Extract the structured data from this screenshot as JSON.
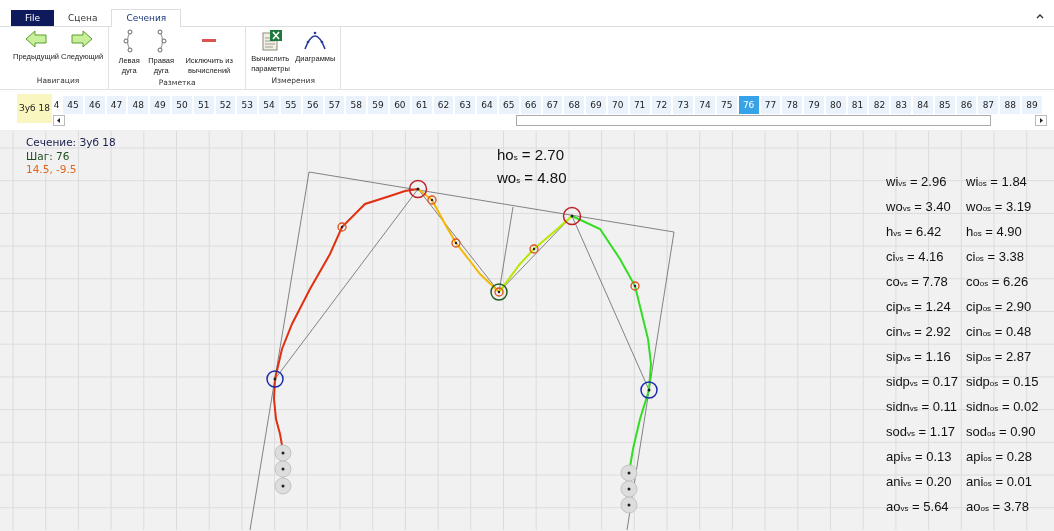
{
  "menu_tabs": [
    {
      "label": "File",
      "kind": "file",
      "selected": false
    },
    {
      "label": "Сцена",
      "kind": "tab",
      "selected": false
    },
    {
      "label": "Сечения",
      "kind": "tab",
      "selected": true
    }
  ],
  "ribbon_groups": [
    {
      "label": "Навигация",
      "buttons": [
        {
          "label": "Предыдущий",
          "kind": "prev"
        },
        {
          "label": "Следующий",
          "kind": "next"
        }
      ]
    },
    {
      "label": "Разметка",
      "buttons": [
        {
          "label": "Левая дуга",
          "kind": "left-arc"
        },
        {
          "label": "Правая дуга",
          "kind": "right-arc"
        },
        {
          "label": "Исключить из вычислений",
          "kind": "exclude"
        }
      ]
    },
    {
      "label": "Измерения",
      "buttons": [
        {
          "label": "Вычислить параметры",
          "kind": "calc"
        },
        {
          "label": "Диаграммы",
          "kind": "chart"
        }
      ]
    }
  ],
  "section_label": "Зуб 18",
  "steps": [
    {
      "label": "4",
      "selected": false
    },
    {
      "label": "45",
      "selected": false
    },
    {
      "label": "46",
      "selected": false
    },
    {
      "label": "47",
      "selected": false
    },
    {
      "label": "48",
      "selected": false
    },
    {
      "label": "49",
      "selected": false
    },
    {
      "label": "50",
      "selected": false
    },
    {
      "label": "51",
      "selected": false
    },
    {
      "label": "52",
      "selected": false
    },
    {
      "label": "53",
      "selected": false
    },
    {
      "label": "54",
      "selected": false
    },
    {
      "label": "55",
      "selected": false
    },
    {
      "label": "56",
      "selected": false
    },
    {
      "label": "57",
      "selected": false
    },
    {
      "label": "58",
      "selected": false
    },
    {
      "label": "59",
      "selected": false
    },
    {
      "label": "60",
      "selected": false
    },
    {
      "label": "61",
      "selected": false
    },
    {
      "label": "62",
      "selected": false
    },
    {
      "label": "63",
      "selected": false
    },
    {
      "label": "64",
      "selected": false
    },
    {
      "label": "65",
      "selected": false
    },
    {
      "label": "66",
      "selected": false
    },
    {
      "label": "67",
      "selected": false
    },
    {
      "label": "68",
      "selected": false
    },
    {
      "label": "69",
      "selected": false
    },
    {
      "label": "70",
      "selected": false
    },
    {
      "label": "71",
      "selected": false
    },
    {
      "label": "72",
      "selected": false
    },
    {
      "label": "73",
      "selected": false
    },
    {
      "label": "74",
      "selected": false
    },
    {
      "label": "75",
      "selected": false
    },
    {
      "label": "76",
      "selected": true
    },
    {
      "label": "77",
      "selected": false
    },
    {
      "label": "78",
      "selected": false
    },
    {
      "label": "79",
      "selected": false
    },
    {
      "label": "80",
      "selected": false
    },
    {
      "label": "81",
      "selected": false
    },
    {
      "label": "82",
      "selected": false
    },
    {
      "label": "83",
      "selected": false
    },
    {
      "label": "84",
      "selected": false
    },
    {
      "label": "85",
      "selected": false
    },
    {
      "label": "86",
      "selected": false
    },
    {
      "label": "87",
      "selected": false
    },
    {
      "label": "88",
      "selected": false
    },
    {
      "label": "89",
      "selected": false
    }
  ],
  "info": [
    {
      "text": "Сечение: Зуб 18",
      "kind": "section"
    },
    {
      "text": "Шаг: 76",
      "kind": "step"
    },
    {
      "text": "14.5, -9.5",
      "kind": "coords"
    }
  ],
  "top_values": [
    "ho$_{s}$ = 2.70",
    "wo$_{s}$ = 4.80"
  ],
  "measurements": [
    [
      "wi$_{vs}$ = 2.96",
      "wi$_{os}$ = 1.84"
    ],
    [
      "wo$_{vs}$ = 3.40",
      "wo$_{os}$ = 3.19"
    ],
    [
      "h$_{vs}$ = 6.42",
      "h$_{os}$ = 4.90"
    ],
    [
      "ci$_{vs}$ = 4.16",
      "ci$_{os}$ = 3.38"
    ],
    [
      "co$_{vs}$ = 7.78",
      "co$_{os}$ = 6.26"
    ],
    [
      "cip$_{vs}$ = 1.24",
      "cip$_{os}$ = 2.90"
    ],
    [
      "cin$_{vs}$ = 2.92",
      "cin$_{os}$ = 0.48"
    ],
    [
      "sip$_{vs}$ = 1.16",
      "sip$_{os}$ = 2.87"
    ],
    [
      "sidp$_{vs}$ = 0.17",
      "sidp$_{os}$ = 0.15"
    ],
    [
      "sidn$_{vs}$ = 0.11",
      "sidn$_{os}$ = 0.02"
    ],
    [
      "sod$_{vs}$ = 1.17",
      "sod$_{os}$ = 0.90"
    ],
    [
      "api$_{vs}$ = 0.13",
      "api$_{os}$ = 0.28"
    ],
    [
      "ani$_{vs}$ = 0.20",
      "ani$_{os}$ = 0.01"
    ],
    [
      "ao$_{vs}$ = 5.64",
      "ao$_{os}$ = 3.78"
    ]
  ]
}
